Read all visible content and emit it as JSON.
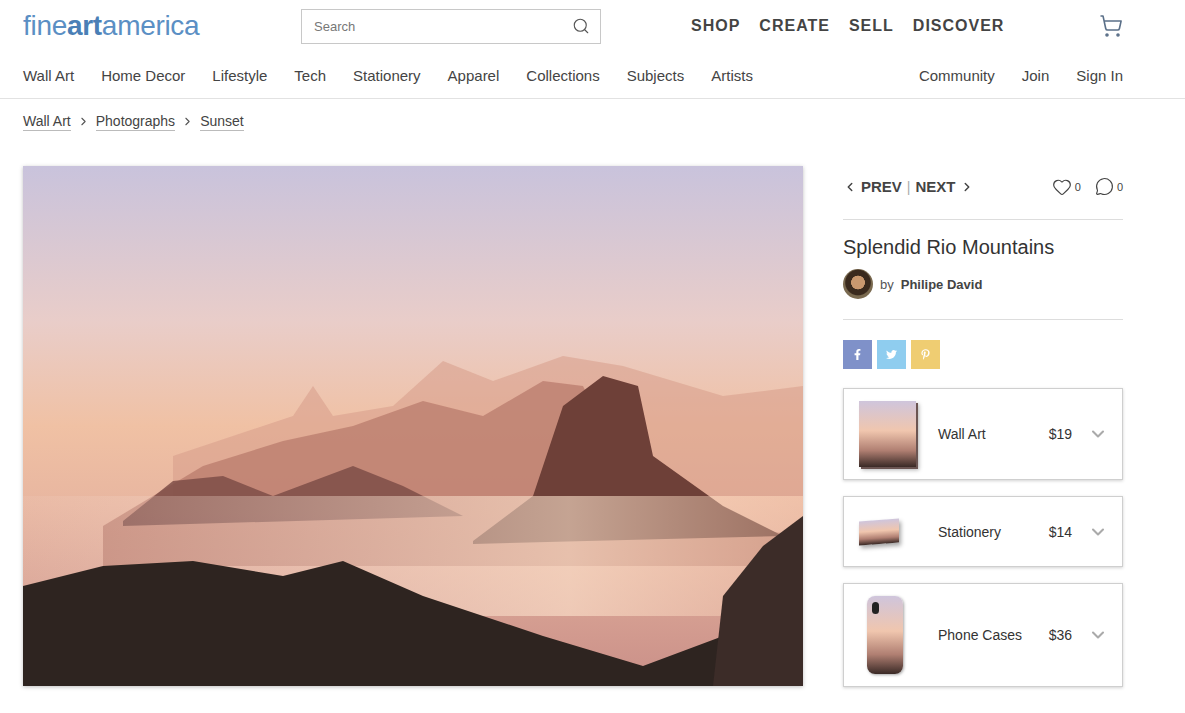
{
  "logo": {
    "before": "fine",
    "bold": "art",
    "after": "america"
  },
  "search": {
    "placeholder": "Search"
  },
  "main_nav": [
    "SHOP",
    "CREATE",
    "SELL",
    "DISCOVER"
  ],
  "category_nav": [
    "Wall Art",
    "Home Decor",
    "Lifestyle",
    "Tech",
    "Stationery",
    "Apparel",
    "Collections",
    "Subjects",
    "Artists"
  ],
  "account_nav": [
    "Community",
    "Join",
    "Sign In"
  ],
  "breadcrumb": [
    "Wall Art",
    "Photographs",
    "Sunset"
  ],
  "pager": {
    "prev": "PREV",
    "separator": "|",
    "next": "NEXT"
  },
  "likes": "0",
  "comments": "0",
  "artwork": {
    "title": "Splendid Rio Mountains",
    "by": "by",
    "artist": "Philipe David"
  },
  "share": [
    {
      "network": "facebook",
      "color": "#7f91c9"
    },
    {
      "network": "twitter",
      "color": "#8fcdef"
    },
    {
      "network": "pinterest",
      "color": "#efcd72"
    }
  ],
  "products": [
    {
      "name": "Wall Art",
      "price": "$19",
      "kind": "canvas"
    },
    {
      "name": "Stationery",
      "price": "$14",
      "kind": "card"
    },
    {
      "name": "Phone Cases",
      "price": "$36",
      "kind": "phone"
    }
  ]
}
